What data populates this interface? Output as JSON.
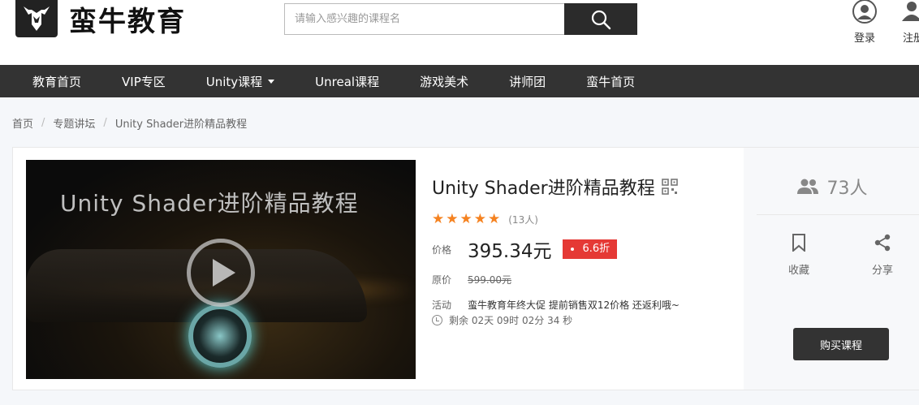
{
  "header": {
    "brand": "蛮牛教育",
    "search_placeholder": "请输入感兴趣的课程名",
    "login_label": "登录",
    "register_label": "注册"
  },
  "nav": {
    "items": [
      "教育首页",
      "VIP专区",
      "Unity课程",
      "Unreal课程",
      "游戏美术",
      "讲师团",
      "蛮牛首页"
    ]
  },
  "breadcrumb": [
    "首页",
    "专题讲坛",
    "Unity Shader进阶精品教程"
  ],
  "course": {
    "video_title": "Unity Shader进阶精品教程",
    "title": "Unity Shader进阶精品教程",
    "stars": 5,
    "rating_count": "(13人)",
    "price_label": "价格",
    "price": "395.34元",
    "discount": "6.6折",
    "orig_label": "原价",
    "orig_price": "599.00元",
    "activity_label": "活动",
    "activity_text": "蛮牛教育年终大促 提前销售双12价格 还返利哦~",
    "countdown": "剩余 02天 09时 02分 34 秒"
  },
  "side": {
    "students": "73人",
    "favorite_label": "收藏",
    "share_label": "分享",
    "buy_label": "购买课程"
  },
  "colors": {
    "nav_bg": "#333333",
    "star": "#f58220",
    "discount_bg": "#e53935"
  }
}
